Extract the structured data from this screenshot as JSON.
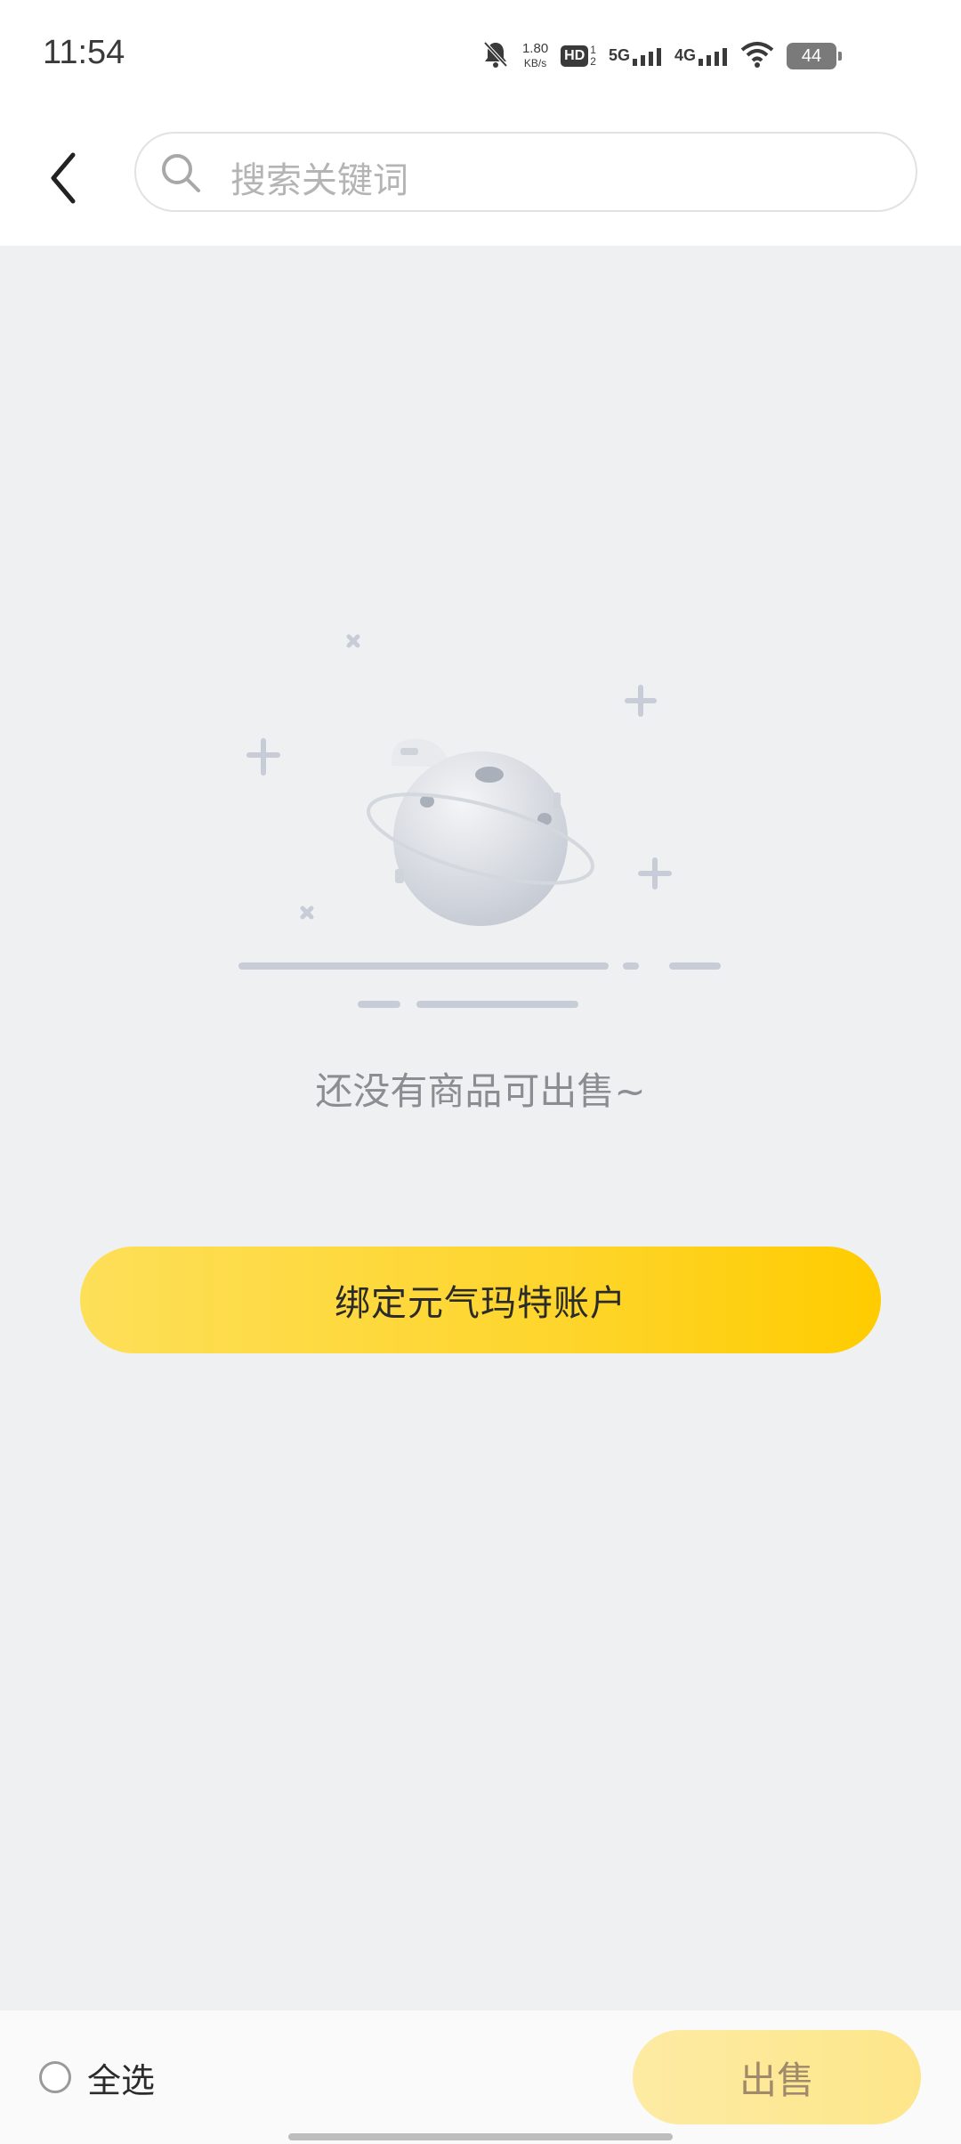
{
  "status_bar": {
    "time": "11:54",
    "net_speed_value": "1.80",
    "net_speed_unit": "KB/s",
    "hd_badge": "HD",
    "sim1_label": "5G",
    "sim2_label": "4G",
    "battery_level": "44"
  },
  "header": {
    "search_placeholder": "搜索关键词"
  },
  "empty_state": {
    "message": "还没有商品可出售~",
    "action_label": "绑定元气玛特账户"
  },
  "bottom_bar": {
    "select_all_label": "全选",
    "sell_label": "出售"
  },
  "colors": {
    "accent_yellow": "#ffcc00",
    "background": "#eff0f2"
  }
}
